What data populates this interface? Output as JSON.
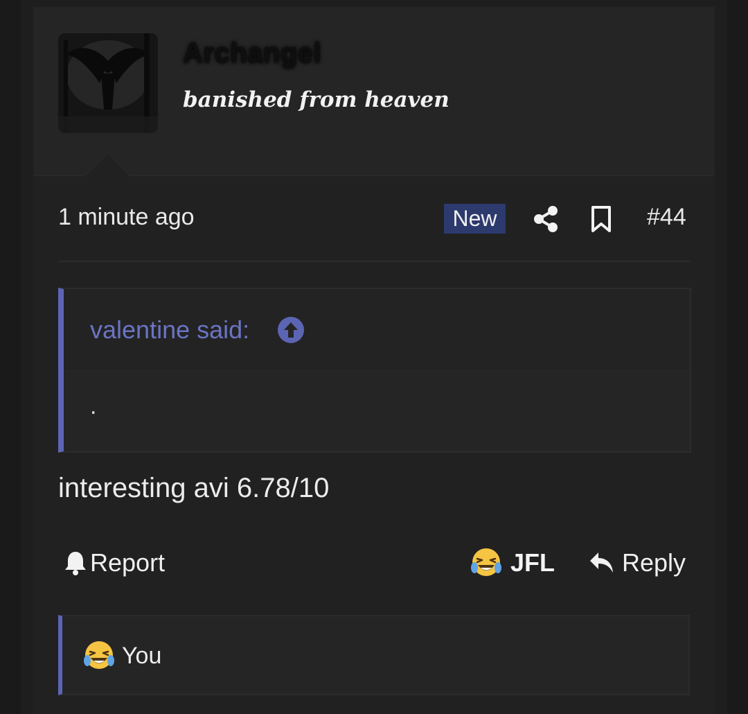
{
  "user": {
    "name": "Archangel",
    "title": "banished from heaven"
  },
  "attribution": {
    "time": "1 minute ago",
    "badge": "New",
    "post_number": "#44"
  },
  "quote": {
    "author": "valentine said:",
    "body": "."
  },
  "message": "interesting avi 6.78/10",
  "actions": {
    "report": "Report",
    "react": "JFL",
    "reply": "Reply"
  },
  "reactions_bar": {
    "text": "You"
  },
  "colors": {
    "accent": "#5c65b3",
    "badge_bg": "#2d3a6e",
    "background": "#212121"
  },
  "icons": {
    "share": "share-icon",
    "bookmark": "bookmark-icon",
    "quote_expand": "arrow-up-circle-icon",
    "report": "bell-icon",
    "reaction": "laughing-crying-emoji-icon",
    "reply": "reply-arrow-icon"
  }
}
